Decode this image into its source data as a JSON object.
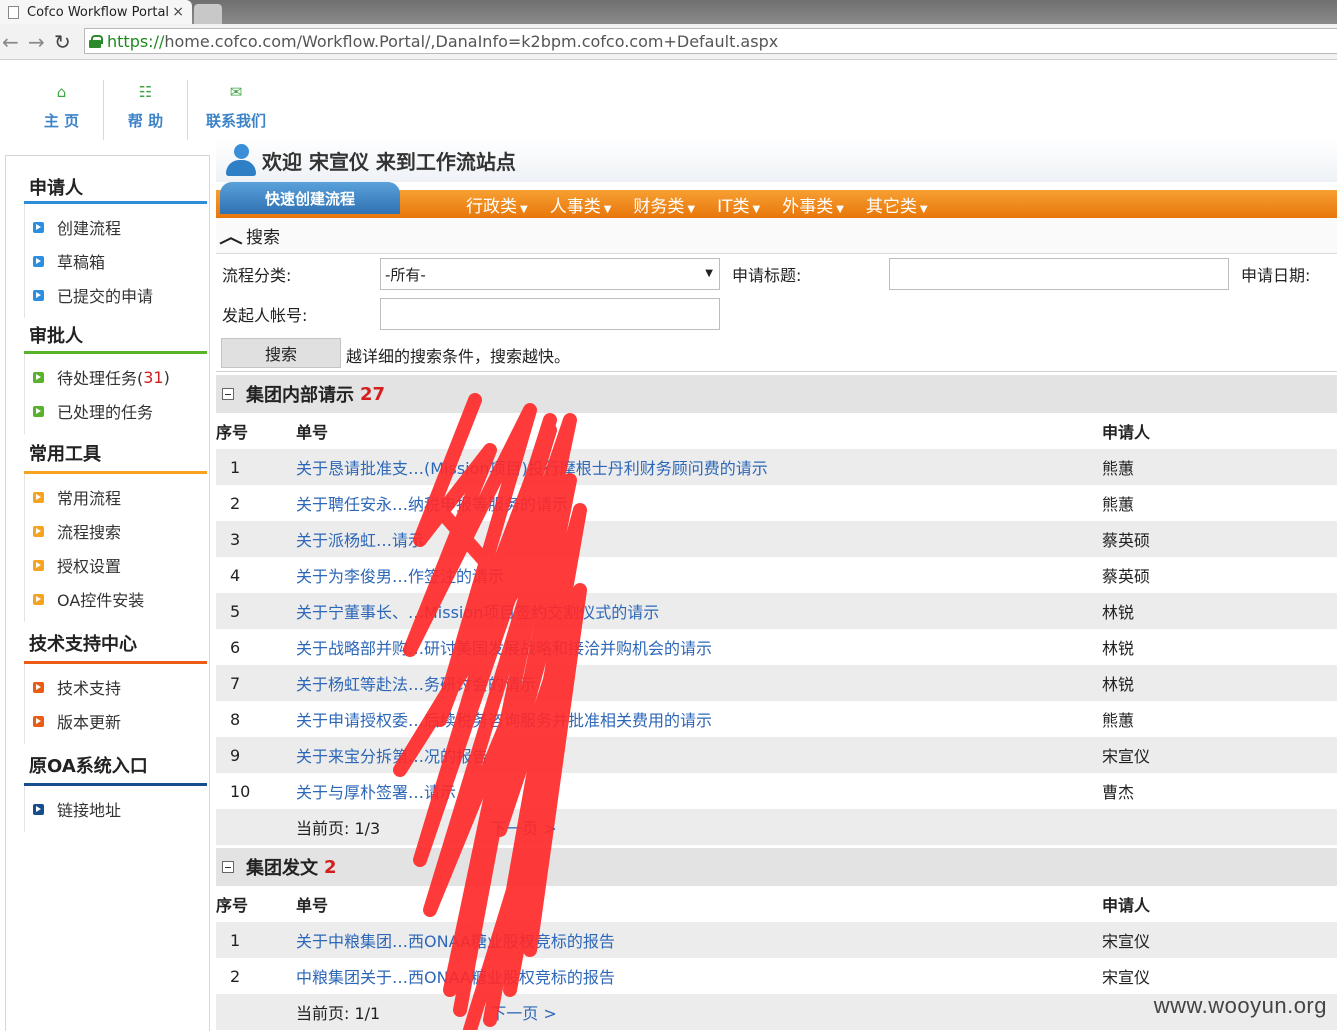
{
  "browser": {
    "tab_title": "Cofco Workflow Portal",
    "tab_close": "×",
    "url_scheme": "https://",
    "url_rest": "home.cofco.com/Workflow.Portal/,DanaInfo=k2bpm.cofco.com+Default.aspx"
  },
  "topnav": [
    {
      "label": "主 页",
      "icon": "home-icon"
    },
    {
      "label": "帮 助",
      "icon": "sitemap-icon"
    },
    {
      "label": "联系我们",
      "icon": "mail-icon"
    }
  ],
  "sidebar": {
    "sections": [
      {
        "title": "申请人",
        "items": [
          {
            "label": "创建流程"
          },
          {
            "label": "草稿箱"
          },
          {
            "label": "已提交的申请"
          }
        ]
      },
      {
        "title": "审批人",
        "items": [
          {
            "label": "待处理任务(",
            "count": "31",
            "suffix": ")"
          },
          {
            "label": "已处理的任务"
          }
        ]
      },
      {
        "title": "常用工具",
        "items": [
          {
            "label": "常用流程"
          },
          {
            "label": "流程搜索"
          },
          {
            "label": "授权设置"
          },
          {
            "label": "OA控件安装"
          }
        ]
      },
      {
        "title": "技术支持中心",
        "items": [
          {
            "label": "技术支持"
          },
          {
            "label": "版本更新"
          }
        ]
      },
      {
        "title": "原OA系统入口",
        "items": [
          {
            "label": "链接地址"
          }
        ]
      }
    ]
  },
  "welcome": "欢迎 宋宣仪 来到工作流站点",
  "quick_create": "快速创建流程",
  "categories": [
    "行政类",
    "人事类",
    "财务类",
    "IT类",
    "外事类",
    "其它类"
  ],
  "search": {
    "title": "搜索",
    "category_label": "流程分类:",
    "category_value": "-所有-",
    "subject_label": "申请标题:",
    "date_label": "申请日期:",
    "initiator_label": "发起人帐号:",
    "button": "搜索",
    "hint": "越详细的搜索条件，搜索越快。"
  },
  "panels": [
    {
      "title": "集团内部请示",
      "count": "27",
      "columns": [
        "序号",
        "单号",
        "申请人"
      ],
      "rows": [
        {
          "no": "1",
          "title": "关于恳请批准支…(Mission项目)投行摩根士丹利财务顾问费的请示",
          "user": "熊蕙"
        },
        {
          "no": "2",
          "title": "关于聘任安永…纳税申报等服务的请示",
          "user": "熊蕙"
        },
        {
          "no": "3",
          "title": "关于派杨虹…请示",
          "user": "蔡英硕"
        },
        {
          "no": "4",
          "title": "关于为李俊男…作签注的请示",
          "user": "蔡英硕"
        },
        {
          "no": "5",
          "title": "关于宁董事长、…Mission项目签约交割仪式的请示",
          "user": "林锐"
        },
        {
          "no": "6",
          "title": "关于战略部并购…研讨美国发展战略和接洽并购机会的请示",
          "user": "林锐"
        },
        {
          "no": "7",
          "title": "关于杨虹等赴法…务研讨会的请示",
          "user": "林锐"
        },
        {
          "no": "8",
          "title": "关于申请授权委…后续税务咨询服务并批准相关费用的请示",
          "user": "熊蕙"
        },
        {
          "no": "9",
          "title": "关于来宝分拆第…况的报告",
          "user": "宋宣仪"
        },
        {
          "no": "10",
          "title": "关于与厚朴签署…请示",
          "user": "曹杰"
        }
      ],
      "pager": {
        "current": "当前页: 1/3",
        "next": "下一页 >"
      }
    },
    {
      "title": "集团发文",
      "count": "2",
      "columns": [
        "序号",
        "单号",
        "申请人"
      ],
      "rows": [
        {
          "no": "1",
          "title": "关于中粮集团…西ONAA糖业股权竞标的报告",
          "user": "宋宣仪"
        },
        {
          "no": "2",
          "title": "中粮集团关于…西ONAA糖业股权竞标的报告",
          "user": "宋宣仪"
        }
      ],
      "pager": {
        "current": "当前页: 1/1",
        "next": "下一页 >"
      }
    }
  ],
  "watermark": "www.wooyun.org",
  "colors": {
    "orange": "#e8760a",
    "blue_tab": "#2f71b3",
    "link": "#2d67b8",
    "count_red": "#d41f1f",
    "redaction": "#ff2a2a"
  }
}
